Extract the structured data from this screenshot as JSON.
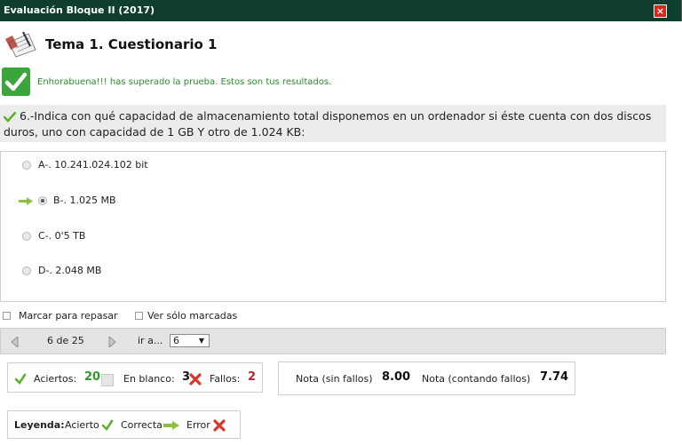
{
  "window": {
    "title": "Evaluación Bloque II (2017)",
    "close_label": "×"
  },
  "header": {
    "title": "Tema 1. Cuestionario 1"
  },
  "result": {
    "message": "Enhorabuena!!! has superado la prueba. Estos son tus resultados."
  },
  "question": {
    "text": "6.-Indica con qué capacidad de almacenamiento total disponemos en un ordenador si éste cuenta con dos discos duros, uno con capacidad de 1 GB Y otro de 1.024 KB:"
  },
  "answers": [
    {
      "label": "A-. 10.241.024.102 bit",
      "selected": false
    },
    {
      "label": "B-. 1.025 MB",
      "selected": true,
      "correct": true
    },
    {
      "label": "C-. 0'5 TB",
      "selected": false
    },
    {
      "label": "D-. 2.048 MB",
      "selected": false
    }
  ],
  "options": {
    "mark_label": "Marcar para repasar",
    "show_marked_label": "Ver sólo marcadas"
  },
  "navigation": {
    "position": "6 de 25",
    "goto_label": "ir a...",
    "goto_value": "6"
  },
  "score": {
    "hits_label": "Aciertos:",
    "hits": "20",
    "blank_label": "En blanco:",
    "blank": "3",
    "fails_label": "Fallos:",
    "fails": "2"
  },
  "grade": {
    "no_penalty_label": "Nota (sin fallos)",
    "no_penalty": "8.00",
    "penalty_label": "Nota (contando fallos)",
    "penalty": "7.74"
  },
  "legend": {
    "title": "Leyenda:",
    "hit": "Acierto",
    "correct": "Correcta",
    "error": "Error"
  },
  "colors": {
    "titlebar": "#0f3d2e",
    "success": "#2c8b2c",
    "error": "#c0262c",
    "close": "#d9261c"
  }
}
